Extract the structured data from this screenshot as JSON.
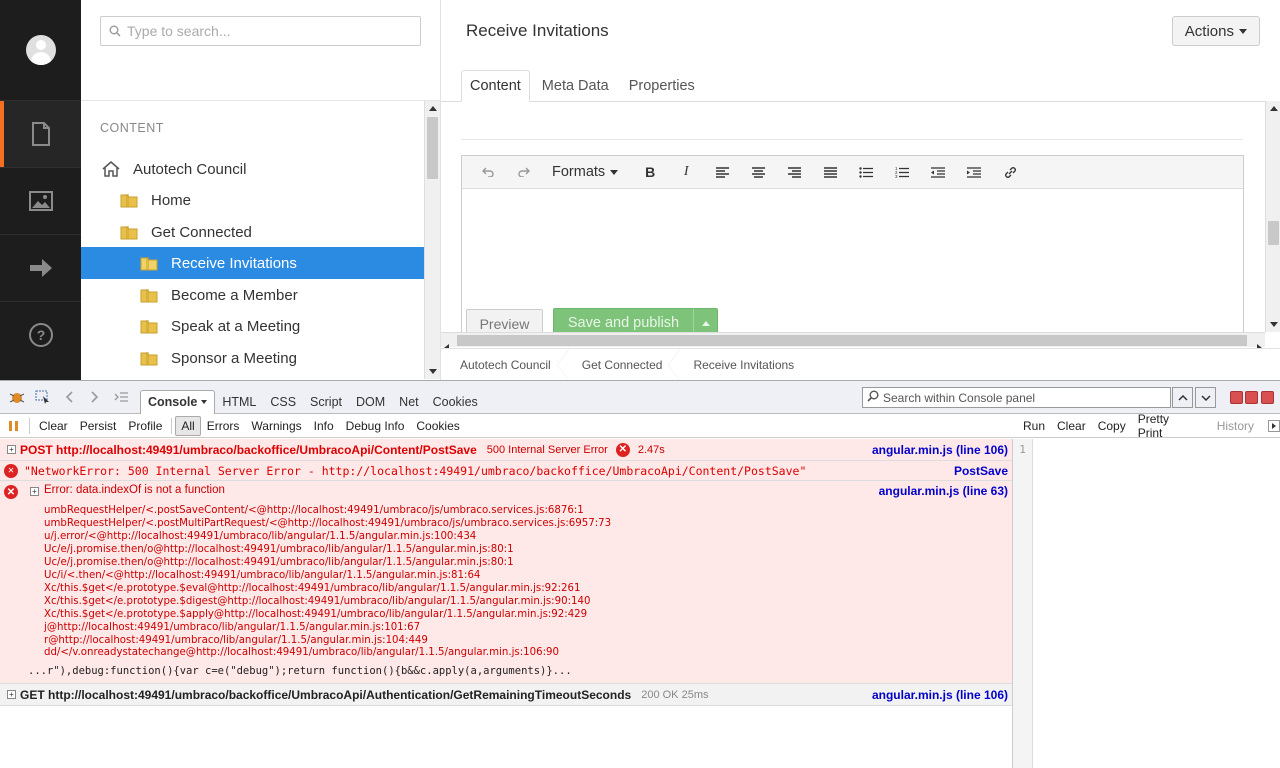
{
  "search": {
    "placeholder": "Type to search..."
  },
  "tree": {
    "section_label": "CONTENT",
    "nodes": [
      {
        "label": "Autotech Council",
        "icon": "home-icon"
      },
      {
        "label": "Home",
        "icon": "folder-icon"
      },
      {
        "label": "Get Connected",
        "icon": "folder-icon"
      },
      {
        "label": "Receive Invitations",
        "icon": "folder-icon",
        "selected": true
      },
      {
        "label": "Become a Member",
        "icon": "folder-icon"
      },
      {
        "label": "Speak at a Meeting",
        "icon": "folder-icon"
      },
      {
        "label": "Sponsor a Meeting",
        "icon": "folder-icon"
      }
    ]
  },
  "editor": {
    "title": "Receive Invitations",
    "actions_label": "Actions",
    "tabs": [
      "Content",
      "Meta Data",
      "Properties"
    ],
    "toolbar": {
      "formats_label": "Formats"
    },
    "preview_label": "Preview",
    "save_publish_label": "Save and publish",
    "breadcrumb": [
      "Autotech Council",
      "Get Connected",
      "Receive Invitations"
    ]
  },
  "firebug": {
    "tabs": [
      "Console",
      "HTML",
      "CSS",
      "Script",
      "DOM",
      "Net",
      "Cookies"
    ],
    "search_placeholder": "Search within Console panel",
    "sub": {
      "clear": "Clear",
      "persist": "Persist",
      "profile": "Profile",
      "filters": [
        "All",
        "Errors",
        "Warnings",
        "Info",
        "Debug Info",
        "Cookies"
      ],
      "run": "Run",
      "clear2": "Clear",
      "copy": "Copy",
      "pretty_print": "Pretty Print",
      "history": "History"
    },
    "rows": {
      "post_method": "POST http://localhost:49491/umbraco/backoffice/UmbracoApi/Content/PostSave",
      "post_status": "500 Internal Server Error",
      "post_time": "2.47s",
      "post_src": "angular.min.js (line 106)",
      "neterr_text": "\"NetworkError: 500 Internal Server Error - http://localhost:49491/umbraco/backoffice/UmbracoApi/Content/PostSave\"",
      "neterr_src": "PostSave",
      "error_title": "Error: data.indexOf is not a function",
      "error_src": "angular.min.js (line 63)",
      "stack": "umbRequestHelper/<.postSaveContent/<@http://localhost:49491/umbraco/js/umbraco.services.js:6876:1\numbRequestHelper/<.postMultiPartRequest/<@http://localhost:49491/umbraco/js/umbraco.services.js:6957:73\nu/j.error/<@http://localhost:49491/umbraco/lib/angular/1.1.5/angular.min.js:100:434\nUc/e/j.promise.then/o@http://localhost:49491/umbraco/lib/angular/1.1.5/angular.min.js:80:1\nUc/e/j.promise.then/o@http://localhost:49491/umbraco/lib/angular/1.1.5/angular.min.js:80:1\nUc/i/<.then/<@http://localhost:49491/umbraco/lib/angular/1.1.5/angular.min.js:81:64\nXc/this.$get</e.prototype.$eval@http://localhost:49491/umbraco/lib/angular/1.1.5/angular.min.js:92:261\nXc/this.$get</e.prototype.$digest@http://localhost:49491/umbraco/lib/angular/1.1.5/angular.min.js:90:140\nXc/this.$get</e.prototype.$apply@http://localhost:49491/umbraco/lib/angular/1.1.5/angular.min.js:92:429\nj@http://localhost:49491/umbraco/lib/angular/1.1.5/angular.min.js:101:67\nr@http://localhost:49491/umbraco/lib/angular/1.1.5/angular.min.js:104:449\ndd/</v.onreadystatechange@http://localhost:49491/umbraco/lib/angular/1.1.5/angular.min.js:106:90",
      "truncated": "...r\"),debug:function(){var c=e(\"debug\");return function(){b&&c.apply(a,arguments)}...",
      "get_method": "GET http://localhost:49491/umbraco/backoffice/UmbracoApi/Authentication/GetRemainingTimeoutSeconds",
      "get_status": "200 OK 25ms",
      "get_src": "angular.min.js (line 106)"
    },
    "cmd_line_number": "1"
  }
}
